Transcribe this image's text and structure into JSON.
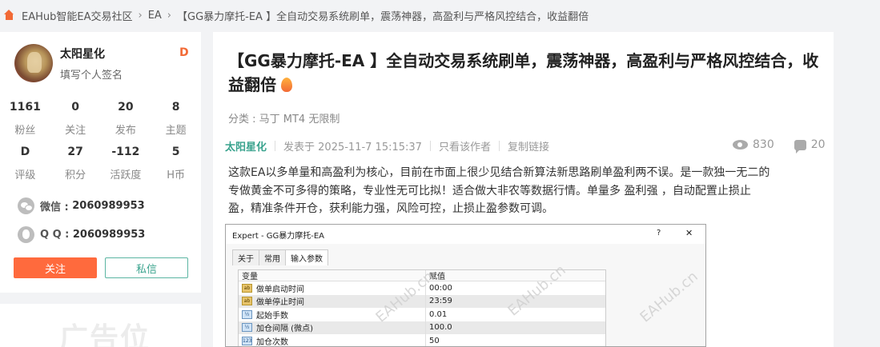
{
  "breadcrumb": [
    "EAHub智能EA交易社区",
    "EA",
    "【GG暴力摩托-EA 】全自动交易系统刷单，震荡神器，高盈利与严格风控结合，收益翻倍"
  ],
  "profile": {
    "name": "太阳星化",
    "signature": "填写个人签名",
    "badge": "D",
    "stats_row1": [
      {
        "value": "1161",
        "label": "粉丝"
      },
      {
        "value": "0",
        "label": "关注"
      },
      {
        "value": "20",
        "label": "发布"
      },
      {
        "value": "8",
        "label": "主题"
      }
    ],
    "stats_row2": [
      {
        "value": "D",
        "label": "评级"
      },
      {
        "value": "27",
        "label": "积分"
      },
      {
        "value": "-112",
        "label": "活跃度"
      },
      {
        "value": "5",
        "label": "H币"
      }
    ],
    "wechat_label": "微信 :",
    "wechat": "2060989953",
    "qq_label": "Q Q :",
    "qq": "2060989953",
    "follow_label": "关注",
    "message_label": "私信"
  },
  "ad": {
    "text": "广告位"
  },
  "post": {
    "title": "【GG暴力摩托-EA 】全自动交易系统刷单，震荡神器，高盈利与严格风控结合，收益翻倍",
    "category": "分类 : 马丁 MT4 无限制",
    "author": "太阳星化",
    "posted": "发表于 2025-11-7 15:15:37",
    "author_only": "只看该作者",
    "copy_link": "复制链接",
    "views": "830",
    "comments": "20",
    "body": "这款EA以多单量和高盈利为核心，目前在市面上很少见结合新算法新思路刷单盈利两不误。是一款独一无二的专做黄金不可多得的策略，专业性无可比拟！适合做大非农等数据行情。单量多 盈利强 ，自动配置止损止盈，精准条件开仓，获利能力强，风险可控，止损止盈参数可调。"
  },
  "dialog": {
    "title": "Expert - GG暴力摩托-EA",
    "help": "?",
    "close": "✕",
    "tabs": [
      "关于",
      "常用",
      "输入参数"
    ],
    "col_var": "变量",
    "col_val": "赋值",
    "rows": [
      {
        "icon": "ab",
        "name": "做单启动时间",
        "value": "00:00"
      },
      {
        "icon": "ab",
        "name": "做单停止时间",
        "value": "23:59"
      },
      {
        "icon": "½",
        "name": "起始手数",
        "value": "0.01"
      },
      {
        "icon": "½",
        "name": "加仓间隔 (微点)",
        "value": "100.0"
      },
      {
        "icon": "123",
        "name": "加仓次数",
        "value": "50"
      }
    ],
    "watermark": "EAHub.cn"
  }
}
